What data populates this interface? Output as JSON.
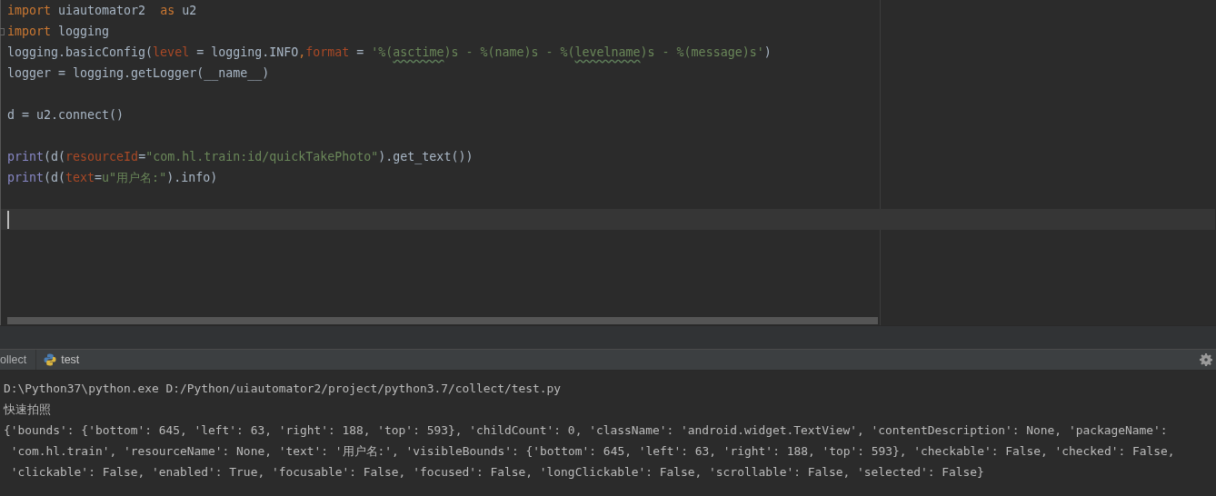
{
  "editor": {
    "lines": [
      {
        "kind": "code",
        "current": false,
        "tokens": [
          {
            "kind": "keyword",
            "text": "import"
          },
          {
            "kind": "plain",
            "text": " uiautomator2  "
          },
          {
            "kind": "keyword",
            "text": "as"
          },
          {
            "kind": "plain",
            "text": " u2"
          }
        ]
      },
      {
        "kind": "code",
        "current": false,
        "folded": false,
        "tokens": [
          {
            "kind": "keyword",
            "text": "import"
          },
          {
            "kind": "plain",
            "text": " logging"
          }
        ]
      },
      {
        "kind": "code",
        "current": false,
        "tokens": [
          {
            "kind": "plain",
            "text": "logging.basicConfig("
          },
          {
            "kind": "param",
            "text": "level"
          },
          {
            "kind": "plain",
            "text": " = logging.INFO"
          },
          {
            "kind": "keyword",
            "text": ","
          },
          {
            "kind": "param",
            "text": "format"
          },
          {
            "kind": "plain",
            "text": " = "
          },
          {
            "kind": "string",
            "text": "'%("
          },
          {
            "kind": "string_flagged",
            "text": "asctime"
          },
          {
            "kind": "string",
            "text": ")s - %(name)s - %("
          },
          {
            "kind": "string_flagged",
            "text": "levelname"
          },
          {
            "kind": "string",
            "text": ")s - %(message)s'"
          },
          {
            "kind": "plain",
            "text": ")"
          }
        ]
      },
      {
        "kind": "code",
        "current": false,
        "tokens": [
          {
            "kind": "plain",
            "text": "logger = logging.getLogger(__name__)"
          }
        ]
      },
      {
        "kind": "blank"
      },
      {
        "kind": "code",
        "current": false,
        "tokens": [
          {
            "kind": "plain",
            "text": "d = u2.connect()"
          }
        ]
      },
      {
        "kind": "blank"
      },
      {
        "kind": "code",
        "current": false,
        "tokens": [
          {
            "kind": "builtin",
            "text": "print"
          },
          {
            "kind": "plain",
            "text": "(d("
          },
          {
            "kind": "param",
            "text": "resourceId"
          },
          {
            "kind": "plain",
            "text": "="
          },
          {
            "kind": "string",
            "text": "\"com.hl.train:id/quickTakePhoto\""
          },
          {
            "kind": "plain",
            "text": ").get_text())"
          }
        ]
      },
      {
        "kind": "code",
        "current": false,
        "tokens": [
          {
            "kind": "builtin",
            "text": "print"
          },
          {
            "kind": "plain",
            "text": "(d("
          },
          {
            "kind": "param",
            "text": "text"
          },
          {
            "kind": "plain",
            "text": "="
          },
          {
            "kind": "string",
            "text": "u\"用户名:\""
          },
          {
            "kind": "plain",
            "text": ").info)"
          }
        ]
      },
      {
        "kind": "blank"
      },
      {
        "kind": "blank",
        "current": true
      }
    ]
  },
  "run_tabs": [
    {
      "label": "ollect",
      "kind": "config",
      "selected": false
    },
    {
      "label": "test",
      "kind": "python",
      "selected": true
    }
  ],
  "console": {
    "lines": [
      "D:\\Python37\\python.exe D:/Python/uiautomator2/project/python3.7/collect/test.py",
      "快速拍照",
      "{'bounds': {'bottom': 645, 'left': 63, 'right': 188, 'top': 593}, 'childCount': 0, 'className': 'android.widget.TextView', 'contentDescription': None, 'packageName':",
      " 'com.hl.train', 'resourceName': None, 'text': '用户名:', 'visibleBounds': {'bottom': 645, 'left': 63, 'right': 188, 'top': 593}, 'checkable': False, 'checked': False,",
      " 'clickable': False, 'enabled': True, 'focusable': False, 'focused': False, 'longClickable': False, 'scrollable': False, 'selected': False}"
    ]
  }
}
